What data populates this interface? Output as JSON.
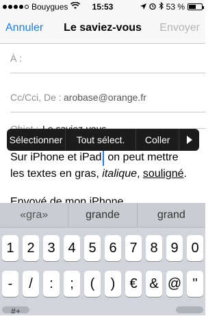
{
  "status_bar": {
    "carrier": "Bouygues",
    "time": "15:53",
    "battery": "53 %",
    "battery_level": 0.53,
    "signal_bars_filled": 4,
    "icons": [
      "wifi-icon",
      "location-icon",
      "alarm-icon",
      "bluetooth-icon",
      "battery-icon"
    ]
  },
  "navbar": {
    "cancel_label": "Annuler",
    "title": "Le saviez-vous",
    "send_label": "Envoyer"
  },
  "fields": {
    "to_label": "À :",
    "cc_label": "Cc/Cci, De :",
    "from_value": "arobase@orange.fr",
    "subject_label": "Objet :",
    "subject_value": "Le saviez-vous"
  },
  "body": {
    "line1": "Sur iPhone et iPad, on peut mettre",
    "line2_plain": "les textes en gras, ",
    "line2_italic": "italique",
    "line2_sep": ", ",
    "line2_underline": "souligné",
    "line2_end": ".",
    "signature": "Envoyé de mon iPhone"
  },
  "popup_menu": {
    "items": [
      "Sélectionner",
      "Tout sélect.",
      "Coller"
    ],
    "more_icon": "triangle-right-icon"
  },
  "suggestions": [
    "«gra»",
    "grande",
    "grand"
  ],
  "keyboard": {
    "row1": [
      "1",
      "2",
      "3",
      "4",
      "5",
      "6",
      "7",
      "8",
      "9",
      "0"
    ],
    "row2": [
      "-",
      "/",
      ":",
      ";",
      "(",
      ")",
      "€",
      "&",
      "@",
      "\""
    ],
    "row3_partial": [
      "#+"
    ]
  },
  "colors": {
    "accent": "#1a7cf3",
    "disabled": "#b4b4b4",
    "popup_bg": "#1c1c1c",
    "keyboard_bg": "#d1d5db"
  }
}
